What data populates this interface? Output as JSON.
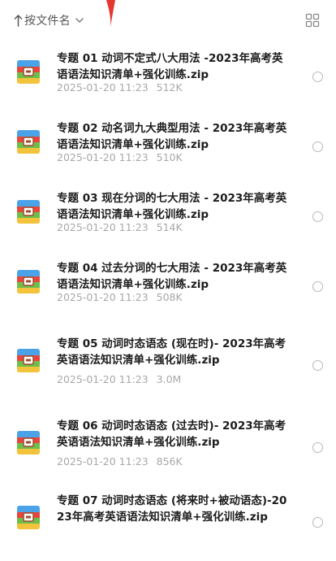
{
  "toolbar": {
    "sort_label": "按文件名",
    "sort_icon": "sort-arrow-up-icon",
    "dropdown_icon": "chevron-down-icon",
    "view_icon": "grid-view-icon"
  },
  "colors": {
    "accent_red": "#e5362f",
    "text": "#1c1c1c",
    "meta": "#a8a8a8"
  },
  "files": [
    {
      "name": "专题 01 动词不定式八大用法 -2023年高考英语语法知识清单+强化训练.zip",
      "date": "2025-01-20 11:23",
      "size": "512K"
    },
    {
      "name": "专题 02 动名词九大典型用法 - 2023年高考英语语法知识清单+强化训练.zip",
      "date": "2025-01-20 11:23",
      "size": "510K"
    },
    {
      "name": "专题 03 现在分词的七大用法 - 2023年高考英语语法知识清单+强化训练.zip",
      "date": "2025-01-20 11:23",
      "size": "514K"
    },
    {
      "name": "专题 04 过去分词的七大用法 - 2023年高考英语语法知识清单+强化训练.zip",
      "date": "2025-01-20 11:23",
      "size": "508K"
    },
    {
      "name": "专题 05 动词时态语态 (现在时)- 2023年高考英语语法知识清单+强化训练.zip",
      "date": "2025-01-20 11:23",
      "size": "3.0M"
    },
    {
      "name": "专题 06 动词时态语态 (过去时)- 2023年高考英语语法知识清单+强化训练.zip",
      "date": "2025-01-20 11:23",
      "size": "856K"
    },
    {
      "name": "专题 07 动词时态语态 (将来时+被动语态)-2023年高考英语语法知识清单+强化训练.zip",
      "date": "",
      "size": ""
    }
  ]
}
